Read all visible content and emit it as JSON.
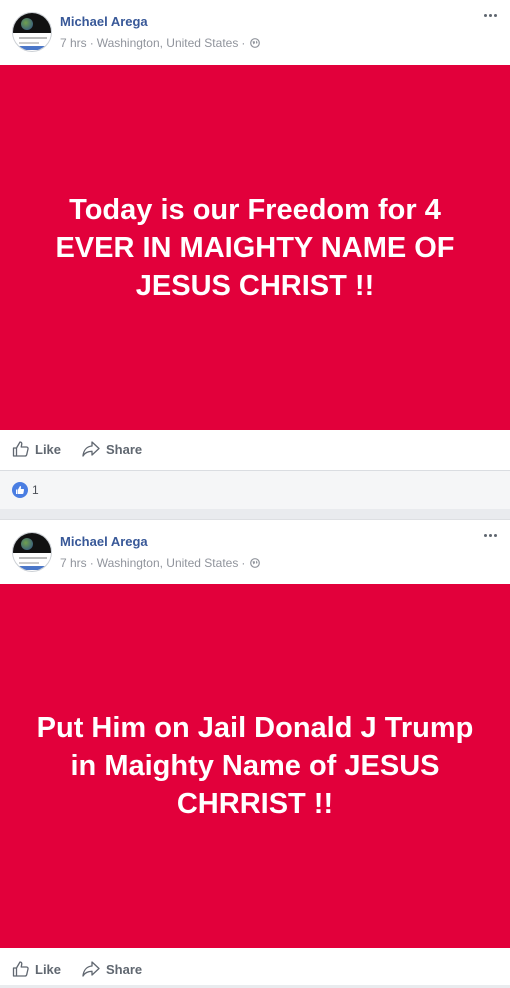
{
  "colors": {
    "banner_bg": "#e2003b",
    "author_link": "#385898",
    "meta_text": "#90949c",
    "like_badge": "#4a7ee2"
  },
  "posts": [
    {
      "author": "Michael Arega",
      "time": "7 hrs",
      "location": "Washington, United States",
      "privacy_icon": "globe-icon",
      "text": "Today is our Freedom for 4 EVER IN MAIGHTY NAME OF JESUS CHRIST !!",
      "actions": {
        "like": "Like",
        "share": "Share"
      },
      "reactions": {
        "icon": "thumbs-up-icon",
        "count": "1"
      }
    },
    {
      "author": "Michael Arega",
      "time": "7 hrs",
      "location": "Washington, United States",
      "privacy_icon": "globe-icon",
      "text": "Put Him on Jail Donald J Trump in Maighty Name of JESUS CHRRIST !!",
      "actions": {
        "like": "Like",
        "share": "Share"
      }
    }
  ]
}
